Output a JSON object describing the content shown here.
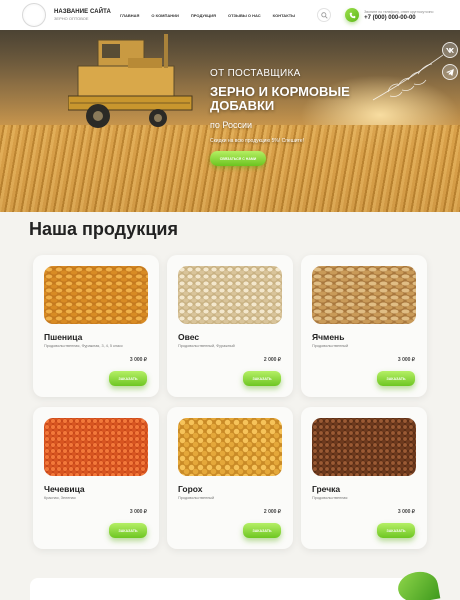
{
  "header": {
    "site_name": "НАЗВАНИЕ САЙТА",
    "site_tagline": "ЗЕРНО ОПТОВОЕ",
    "nav": [
      "ГЛАВНАЯ",
      "О КОМПАНИИ",
      "ПРОДУКЦИЯ",
      "ОТЗЫВЫ О НАС",
      "КОНТАКТЫ"
    ],
    "contact_note": "Звоните по телефону, ответ круглосуточно",
    "phone": "+7 (000) 000-00-00"
  },
  "hero": {
    "title_small": "ОТ ПОСТАВЩИКА",
    "title_main": "ЗЕРНО И КОРМОВЫЕ ДОБАВКИ",
    "region": "по России",
    "promo": "Скидки на всю продукцию 5%! Спешите!",
    "cta_label": "СВЯЗАТЬСЯ С НАМИ"
  },
  "products": {
    "title": "Наша продукция",
    "order_label": "ЗАКАЗАТЬ",
    "items": [
      {
        "name": "Пшеница",
        "desc": "Продовольственная, Фуражная, 3, 4, 5 класс",
        "price": "3 000 ₽",
        "grain": "wheat"
      },
      {
        "name": "Овес",
        "desc": "Продовольственный, Фуражный",
        "price": "2 000 ₽",
        "grain": "oats"
      },
      {
        "name": "Ячмень",
        "desc": "Продовольственный",
        "price": "3 000 ₽",
        "grain": "barley"
      },
      {
        "name": "Чечевица",
        "desc": "Красная, Зеленая",
        "price": "3 000 ₽",
        "grain": "lentil"
      },
      {
        "name": "Горох",
        "desc": "Продовольственный",
        "price": "2 000 ₽",
        "grain": "peas"
      },
      {
        "name": "Гречка",
        "desc": "Продовольственная",
        "price": "3 000 ₽",
        "grain": "buckwheat"
      }
    ]
  },
  "colors": {
    "accent": "#7ccd2a",
    "text": "#222222",
    "background": "#f4f3ef"
  },
  "icons": [
    "search-icon",
    "phone-icon",
    "vk-icon",
    "telegram-icon"
  ]
}
